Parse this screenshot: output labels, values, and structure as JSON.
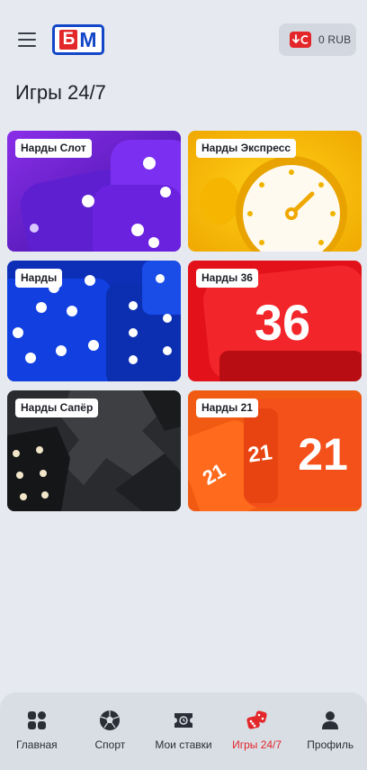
{
  "header": {
    "logo_left": "Б",
    "logo_right": "М",
    "balance": "0 RUB"
  },
  "page": {
    "title": "Игры 24/7"
  },
  "games": [
    {
      "label": "Нарды Слот"
    },
    {
      "label": "Нарды Экспресс"
    },
    {
      "label": "Нарды"
    },
    {
      "label": "Нарды 36"
    },
    {
      "label": "Нарды Сапёр"
    },
    {
      "label": "Нарды 21"
    }
  ],
  "card_art": {
    "dial_number": "36",
    "cube_number": "21"
  },
  "nav": {
    "items": [
      {
        "label": "Главная",
        "icon": "home-grid-icon"
      },
      {
        "label": "Спорт",
        "icon": "soccer-ball-icon"
      },
      {
        "label": "Мои ставки",
        "icon": "ticket-icon"
      },
      {
        "label": "Игры 24/7",
        "icon": "dice-icon",
        "active": true
      },
      {
        "label": "Профиль",
        "icon": "user-icon"
      }
    ]
  },
  "colors": {
    "accent": "#e3262a",
    "brand_blue": "#1346c8",
    "background": "#e6e9ef"
  }
}
